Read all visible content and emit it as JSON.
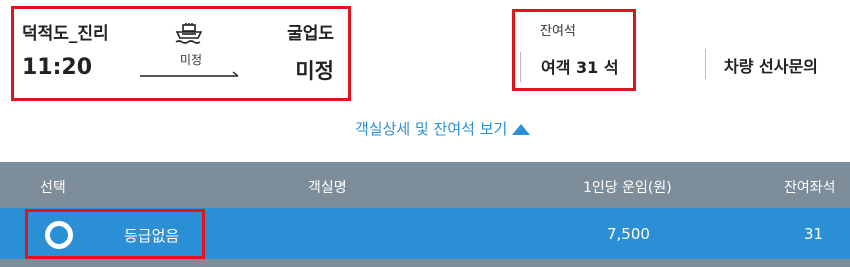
{
  "route": {
    "departure_port": "덕적도_진리",
    "departure_time": "11:20",
    "arrival_port": "굴업도",
    "arrival_time": "미정",
    "duration": "미정"
  },
  "seats": {
    "title": "잔여석",
    "count_label": "여객 31 석"
  },
  "vehicle_inquiry": "차량 선사문의",
  "detail_toggle": "객실상세 및 잔여석 보기",
  "table": {
    "headers": [
      "선택",
      "객실명",
      "1인당 운임(원)",
      "잔여좌석"
    ],
    "rows": [
      {
        "grade": "등급없음",
        "fare": "7,500",
        "remaining": "31"
      }
    ]
  },
  "colors": {
    "accent": "#2b8fd6",
    "header_bg": "#7e8d9a",
    "highlight": "#e0141e"
  }
}
